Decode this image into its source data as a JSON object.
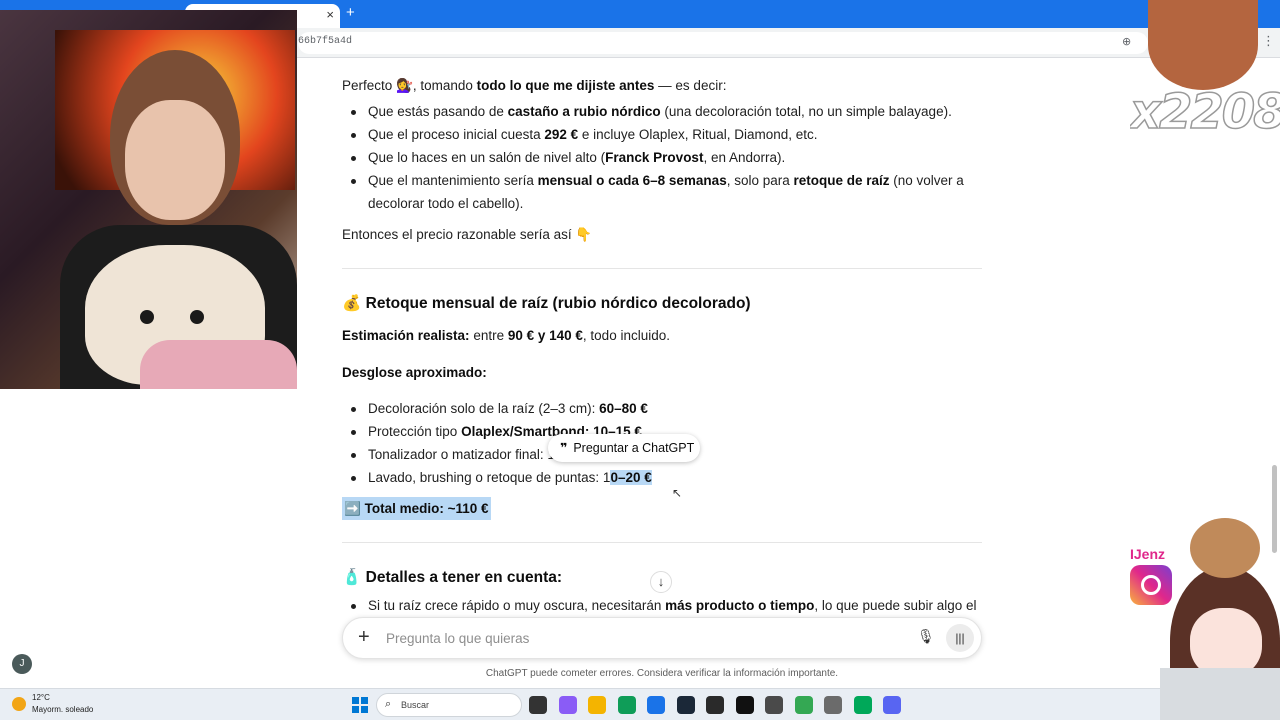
{
  "browser": {
    "url_fragment": "66b7f5a4d",
    "tab_close": "×",
    "new_tab": "+"
  },
  "chat": {
    "intro": [
      "Perfecto ",
      "💇‍♀️",
      ", tomando ",
      "todo lo que me dijiste antes",
      " — es decir:"
    ],
    "bullets1": [
      [
        "Que estás pasando de ",
        "castaño a rubio nórdico",
        " (una decoloración total, no un simple balayage)."
      ],
      [
        "Que el proceso inicial cuesta ",
        "292 €",
        " e incluye Olaplex, Ritual, Diamond, etc."
      ],
      [
        "Que lo haces en un salón de nivel alto (",
        "Franck Provost",
        ", en Andorra)."
      ],
      [
        "Que el mantenimiento sería ",
        "mensual o cada 6–8 semanas",
        ", solo para ",
        "retoque de raíz",
        " (no volver a decolorar todo el cabello)."
      ]
    ],
    "then": "Entonces el precio razonable sería así 👇",
    "section1_icon": "💰",
    "section1_title": "Retoque mensual de raíz (rubio nórdico decolorado)",
    "estimate_label": "Estimación realista:",
    "estimate_mid": " entre ",
    "estimate_value": "90 € y 140 €",
    "estimate_end": ", todo incluido.",
    "breakdown_title": "Desglose aproximado:",
    "bullets2": [
      [
        "Decoloración solo de la raíz (2–3 cm): ",
        "60–80 €"
      ],
      [
        "Protección tipo ",
        "Olaplex/Smartbond: 10–15 €"
      ],
      [
        "Tonalizador o matizador final: ",
        "1"
      ],
      [
        "Lavado, brushing o retoque de puntas: 1",
        "0–20 €"
      ]
    ],
    "total_icon": "➡️",
    "total": "Total medio: ~110 €",
    "section2_icon": "🧴",
    "section2_title": "Detalles a tener en cuenta:",
    "bullet3": [
      "Si tu raíz crece rápido o muy oscura, necesitarán ",
      "más producto o tiempo",
      ", lo que puede subir algo el"
    ]
  },
  "popup": {
    "quote_icon": "❞",
    "label": "Preguntar a ChatGPT"
  },
  "scroll_down_icon": "↓",
  "composer": {
    "plus": "+",
    "placeholder": "Pregunta lo que quieras",
    "mic_icon": "🎙",
    "voice_icon": "|||"
  },
  "disclaimer": "ChatGPT puede cometer errores. Considera verificar la información importante.",
  "sidebar_user_initial": "J",
  "taskbar": {
    "temperature": "12°C",
    "condition": "Mayorm. soleado",
    "search_label": "Buscar",
    "app_colors": [
      "#333333",
      "#8a5cf6",
      "#f4b400",
      "#0f9d58",
      "#1a73e8",
      "#1b2838",
      "#2a2a2a",
      "#111111",
      "#4a4a4a",
      "#34a853",
      "#6b6b6b",
      "#00a859",
      "#5865f2"
    ]
  },
  "overlay": {
    "meme_text": "x2208",
    "insta_name": "IJenz"
  }
}
